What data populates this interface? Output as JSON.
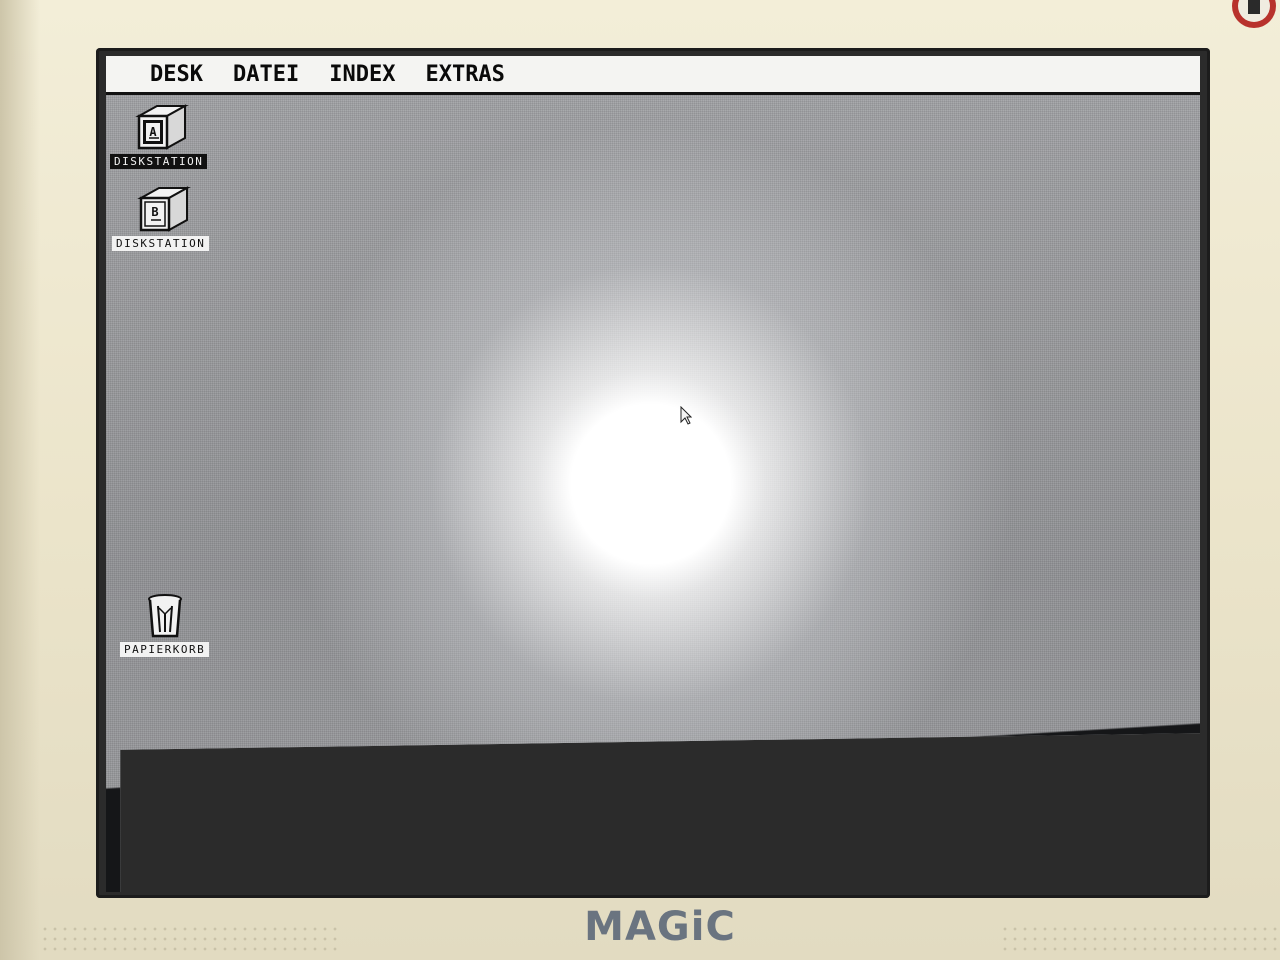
{
  "menubar": {
    "items": [
      {
        "label": "DESK"
      },
      {
        "label": "DATEI"
      },
      {
        "label": "INDEX"
      },
      {
        "label": "EXTRAS"
      }
    ]
  },
  "desktop": {
    "icons": [
      {
        "label": "DISKSTATION",
        "drive": "A",
        "selected": true,
        "icon": "drive-cabinet-icon"
      },
      {
        "label": "DISKSTATION",
        "drive": "B",
        "selected": false,
        "icon": "drive-cabinet-icon"
      },
      {
        "label": "PAPIERKORB",
        "selected": false,
        "icon": "trash-can-icon"
      }
    ]
  },
  "hardware": {
    "brand": "MAGiC"
  },
  "colors": {
    "menubar_bg": "#f4f4f2",
    "desktop_pattern": "#9a9b9e",
    "bezel": "#ece6cf",
    "brand": "#6a7480"
  }
}
